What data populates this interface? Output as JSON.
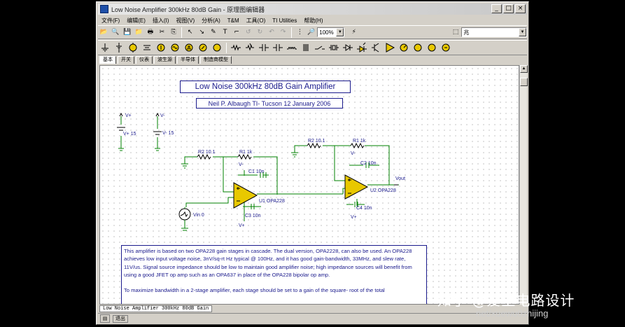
{
  "window": {
    "title": "Low Noise Amplifier 300kHz 80dB Gain - 原理图编辑器",
    "minimize": "0",
    "maximize": "1",
    "close": "x"
  },
  "menu": [
    "文件(F)",
    "编辑(E)",
    "插入(I)",
    "视图(V)",
    "分析(A)",
    "T&M",
    "工具(O)",
    "TI Utilities",
    "帮助(H)"
  ],
  "toolbar": {
    "zoom": "100%",
    "net_combo": "兆"
  },
  "component_tabs": [
    "基本",
    "开关",
    "仪表",
    "波生源",
    "半导体",
    "制造商模型"
  ],
  "icons": {
    "accent": "#e8c800",
    "wire": "#008000",
    "text": "#1a1a8c"
  },
  "schematic": {
    "title": "Low Noise 300kHz 80dB Gain Amplifier",
    "author": "Neil P. Albaugh  TI- Tucson  12 January 2006",
    "labels": {
      "vplus_top": "V+",
      "vplus_val": "V+ 15",
      "vminus_top": "V-",
      "vminus_val": "V- 15",
      "r2a": "R2 10.1",
      "r1a": "R1 1k",
      "vminus_a": "V-",
      "c1": "C1 10n",
      "u1": "U1 OPA228",
      "c3": "C3 10n",
      "vplus_a": "V+",
      "vin": "Vin 0",
      "r2b": "R2 10.1",
      "r1b": "R1 1k",
      "vminus_b": "V-",
      "c2": "C2 10n",
      "vout": "Vout",
      "u2": "U2 OPA228",
      "c4": "C4 10n",
      "vplus_b": "V+"
    },
    "description": [
      "This amplifier is based on two OPA228 gain stages in cascade. The dual version, OPA2228, can also be used. An OPA228 achieves low input voltage noise, 3nV/sq-rt Hz typical @ 100Hz, and it has good gain-bandwidth, 33MHz, and slew rate, 11V/us. Signal source impedance should be low to maintain good amplifier noise; high impedance sources will benefit from using a good JFET op amp such as an OPA637 in place of the OPA228 bipolar op amp.",
      "To maximize bandwidth in a 2-stage amplifier, each stage should be set to a gain of the square- root of the total"
    ]
  },
  "document_tab": "Low Noise Amplifier 300kHz 80dB Gain",
  "status": {
    "message": "退出"
  },
  "watermark": {
    "brand": "知乎 @爱上电路设计",
    "url": "net/xuewu0zhijing"
  }
}
